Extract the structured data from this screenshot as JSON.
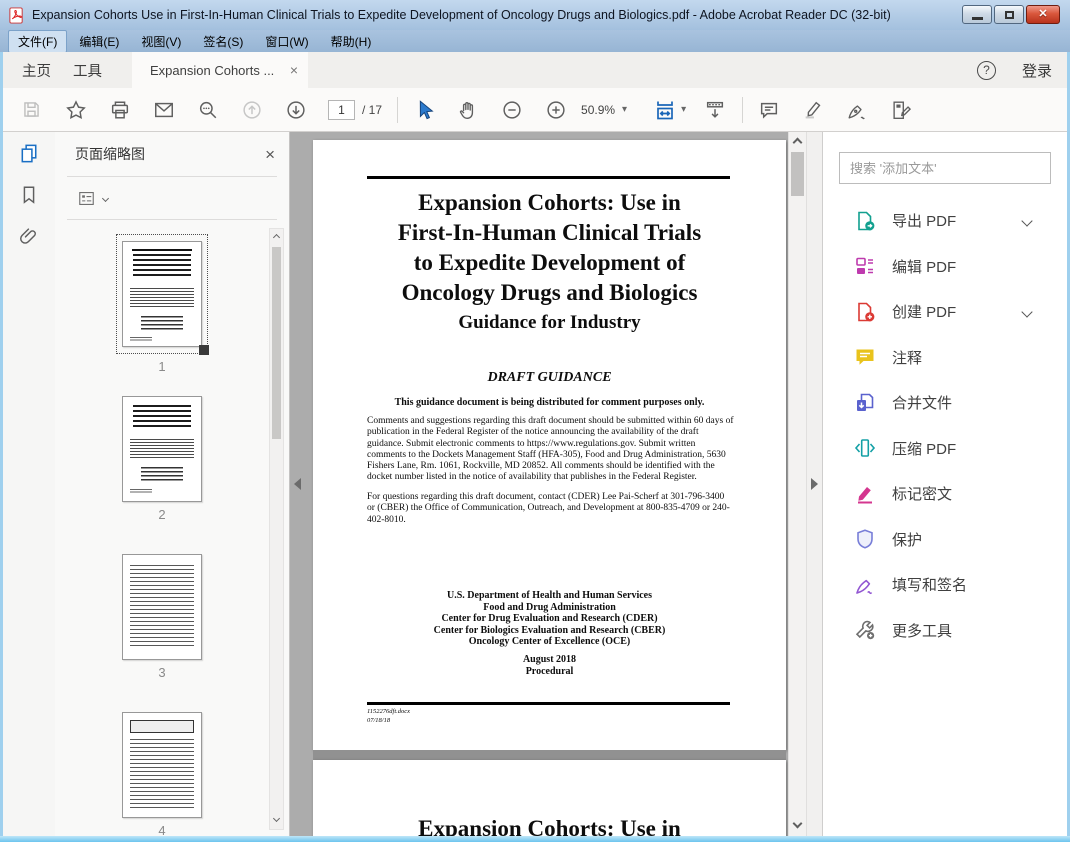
{
  "window": {
    "title": "Expansion Cohorts Use in First-In-Human Clinical Trials to Expedite Development of Oncology Drugs and Biologics.pdf - Adobe Acrobat Reader DC (32-bit)",
    "controls": {
      "close_glyph": "✕"
    }
  },
  "menu_bar": {
    "items": [
      {
        "label": "文件(F)"
      },
      {
        "label": "编辑(E)"
      },
      {
        "label": "视图(V)"
      },
      {
        "label": "签名(S)"
      },
      {
        "label": "窗口(W)"
      },
      {
        "label": "帮助(H)"
      }
    ]
  },
  "tab_bar": {
    "home_label": "主页",
    "tools_label": "工具",
    "document_tab_label": "Expansion Cohorts ...",
    "document_tab_close_glyph": "×",
    "help_glyph": "?",
    "sign_in_label": "登录"
  },
  "toolbar": {
    "page_number": "1",
    "page_total": "/ 17",
    "zoom_level": "50.9%",
    "caret_glyph": "▾"
  },
  "thumbnail_panel": {
    "title": "页面缩略图",
    "close_glyph": "×",
    "pages": [
      {
        "label": "1"
      },
      {
        "label": "2"
      },
      {
        "label": "3"
      },
      {
        "label": "4"
      }
    ]
  },
  "document": {
    "page1": {
      "title_lines": [
        "Expansion Cohorts:  Use in",
        "First-In-Human Clinical Trials",
        "to Expedite Development of",
        "Oncology Drugs and Biologics"
      ],
      "subtitle": "Guidance for Industry",
      "draft_label": "DRAFT GUIDANCE",
      "distribution_notice": "This guidance document is being distributed for comment purposes only.",
      "comments_paragraph": "Comments and suggestions regarding this draft document should be submitted within 60 days of publication in the Federal Register of the notice announcing the availability of the draft guidance.  Submit electronic comments to https://www.regulations.gov.  Submit written comments to the Dockets Management Staff (HFA-305), Food and Drug Administration, 5630 Fishers Lane, Rm. 1061, Rockville, MD  20852.  All comments should be identified with the docket number listed in the notice of availability that publishes in the Federal Register.",
      "contact_paragraph": "For questions regarding this draft document, contact (CDER) Lee Pai-Scherf at 301-796-3400 or (CBER) the Office of Communication, Outreach, and Development at 800-835-4709 or 240-402-8010.",
      "org_lines": [
        "U.S. Department of Health and Human Services",
        "Food and Drug Administration",
        "Center for Drug Evaluation and Research (CDER)",
        "Center for Biologics Evaluation and Research (CBER)",
        "Oncology Center of Excellence (OCE)"
      ],
      "date_line": "August 2018",
      "type_line": "Procedural",
      "footer_doc_id": "1152276dft.docx",
      "footer_date": "07/18/18"
    },
    "page2_heading_partial": "Expansion Cohorts:  Use in"
  },
  "right_panel": {
    "search_placeholder": "搜索 '添加文本'",
    "tools": [
      {
        "label": "导出 PDF",
        "icon": "export-pdf-icon",
        "color": "#12A08F",
        "expandable": true
      },
      {
        "label": "编辑 PDF",
        "icon": "edit-pdf-icon",
        "color": "#BE3AAE",
        "expandable": false
      },
      {
        "label": "创建 PDF",
        "icon": "create-pdf-icon",
        "color": "#DB3A34",
        "expandable": true
      },
      {
        "label": "注释",
        "icon": "comment-tool-icon",
        "color": "#E9C31C",
        "expandable": false
      },
      {
        "label": "合并文件",
        "icon": "combine-files-icon",
        "color": "#5A62CE",
        "expandable": false
      },
      {
        "label": "压缩 PDF",
        "icon": "compress-pdf-icon",
        "color": "#13A0A6",
        "expandable": false
      },
      {
        "label": "标记密文",
        "icon": "redact-icon",
        "color": "#D4368F",
        "expandable": false
      },
      {
        "label": "保护",
        "icon": "protect-icon",
        "color": "#787ED8",
        "expandable": false
      },
      {
        "label": "填写和签名",
        "icon": "fill-sign-icon",
        "color": "#9257D2",
        "expandable": false
      },
      {
        "label": "更多工具",
        "icon": "more-tools-icon",
        "color": "#6E6E6E",
        "expandable": false
      }
    ]
  },
  "colors": {
    "accent_blue": "#1a6fc4",
    "titlebar_blue": "#a3c0de",
    "doc_background_gray": "#acacac"
  }
}
